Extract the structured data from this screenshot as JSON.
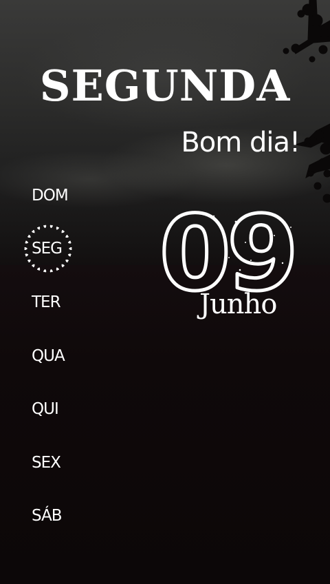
{
  "day_name": "SEGUNDA",
  "greeting": "Bom dia!",
  "weekdays": [
    "DOM",
    "SEG",
    "TER",
    "QUA",
    "QUI",
    "SEX",
    "SÁB"
  ],
  "selected_weekday": "SEG",
  "date": {
    "day": "09",
    "month": "Junho"
  }
}
